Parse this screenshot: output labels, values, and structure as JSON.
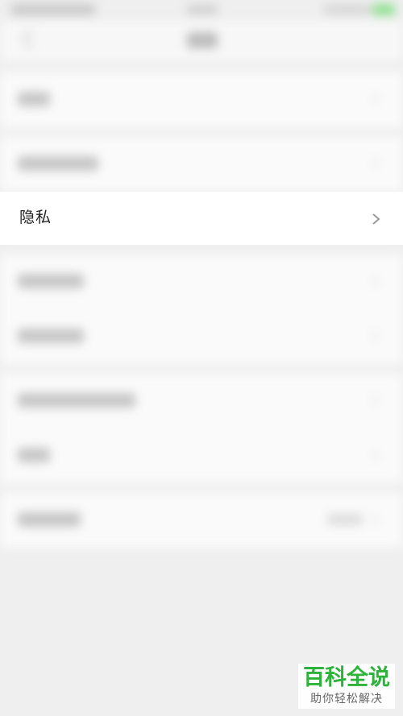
{
  "screen": {
    "privacy_row": {
      "label": "隐私",
      "chevron_icon": "chevron-right-icon"
    }
  },
  "watermark": {
    "title": "百科全说",
    "subtitle": "助你轻松解决"
  },
  "colors": {
    "accent": "#2db33a",
    "background": "#efefef"
  }
}
